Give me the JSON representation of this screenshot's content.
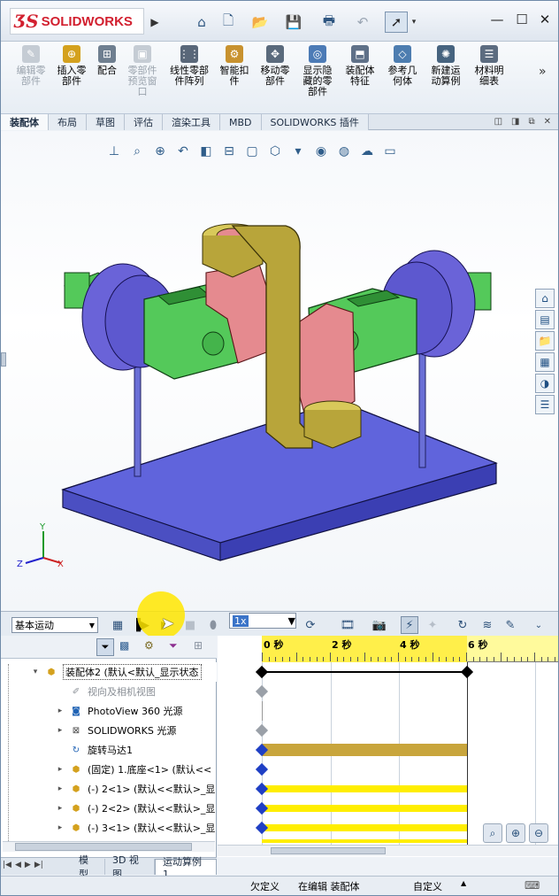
{
  "app": {
    "name": "SOLIDWORKS",
    "logo_prefix": "3S"
  },
  "ribbon": {
    "buttons": [
      {
        "label": "编辑零\n部件",
        "disabled": true,
        "color": "#b9c1cb"
      },
      {
        "label": "插入零\n部件",
        "disabled": false,
        "color": "#d4a11e"
      },
      {
        "label": "配合",
        "disabled": false,
        "color": "#6f7f90"
      },
      {
        "label": "零部件\n预览窗\n口",
        "disabled": true,
        "color": "#b9c1cb"
      },
      {
        "label": "线性零部\n件阵列",
        "disabled": false,
        "color": "#596779"
      },
      {
        "label": "智能扣\n件",
        "disabled": false,
        "color": "#c8922f"
      },
      {
        "label": "移动零\n部件",
        "disabled": false,
        "color": "#5a6a7c"
      },
      {
        "label": "显示隐\n藏的零\n部件",
        "disabled": false,
        "color": "#4c7bb6"
      },
      {
        "label": "装配体\n特征",
        "disabled": false,
        "color": "#5f7188"
      },
      {
        "label": "参考几\n何体",
        "disabled": false,
        "color": "#4d7db0"
      },
      {
        "label": "新建运\n动算例",
        "disabled": false,
        "color": "#46637f"
      },
      {
        "label": "材料明\n细表",
        "disabled": false,
        "color": "#5c6c80"
      }
    ]
  },
  "tabs": [
    "装配体",
    "布局",
    "草图",
    "评估",
    "渲染工具",
    "MBD",
    "SOLIDWORKS 插件"
  ],
  "active_tab": "装配体",
  "motion": {
    "study_type": "基本运动",
    "speed": "1x"
  },
  "timeline": {
    "labels": [
      "0 秒",
      "2 秒",
      "4 秒",
      "6 秒"
    ],
    "playhead_seconds": 6
  },
  "tree": {
    "root": "装配体2 (默认<默认_显示状态",
    "items": [
      {
        "label": "视向及相机视图",
        "expandable": false,
        "icon": "camera-icon",
        "disabled": true
      },
      {
        "label": "PhotoView 360 光源",
        "expandable": true,
        "icon": "photoview-light-icon",
        "disabled": false
      },
      {
        "label": "SOLIDWORKS 光源",
        "expandable": true,
        "icon": "light-icon",
        "disabled": false
      },
      {
        "label": "旋转马达1",
        "expandable": false,
        "icon": "motor-icon",
        "disabled": false
      },
      {
        "label": "(固定) 1.底座<1> (默认<<",
        "expandable": true,
        "icon": "part-icon",
        "disabled": false
      },
      {
        "label": "(-) 2<1> (默认<<默认>_显",
        "expandable": true,
        "icon": "part-icon",
        "disabled": false
      },
      {
        "label": "(-) 2<2> (默认<<默认>_显",
        "expandable": true,
        "icon": "part-icon",
        "disabled": false
      },
      {
        "label": "(-) 3<1> (默认<<默认>_显",
        "expandable": true,
        "icon": "part-icon",
        "disabled": false
      }
    ]
  },
  "bottom_tabs": [
    "模型",
    "3D 视图",
    "运动算例 1"
  ],
  "active_bottom_tab": "运动算例 1",
  "status": {
    "under_defined": "欠定义",
    "editing": "在编辑 装配体",
    "custom": "自定义"
  },
  "colors": {
    "base": "#5b5fd6",
    "cylinder": "#6a63d8",
    "green": "#54c95a",
    "pink": "#e58a8f",
    "olive": "#b8a53a",
    "timeline_yellow": "#ffef4a",
    "motor_bar": "#c8a53c"
  }
}
